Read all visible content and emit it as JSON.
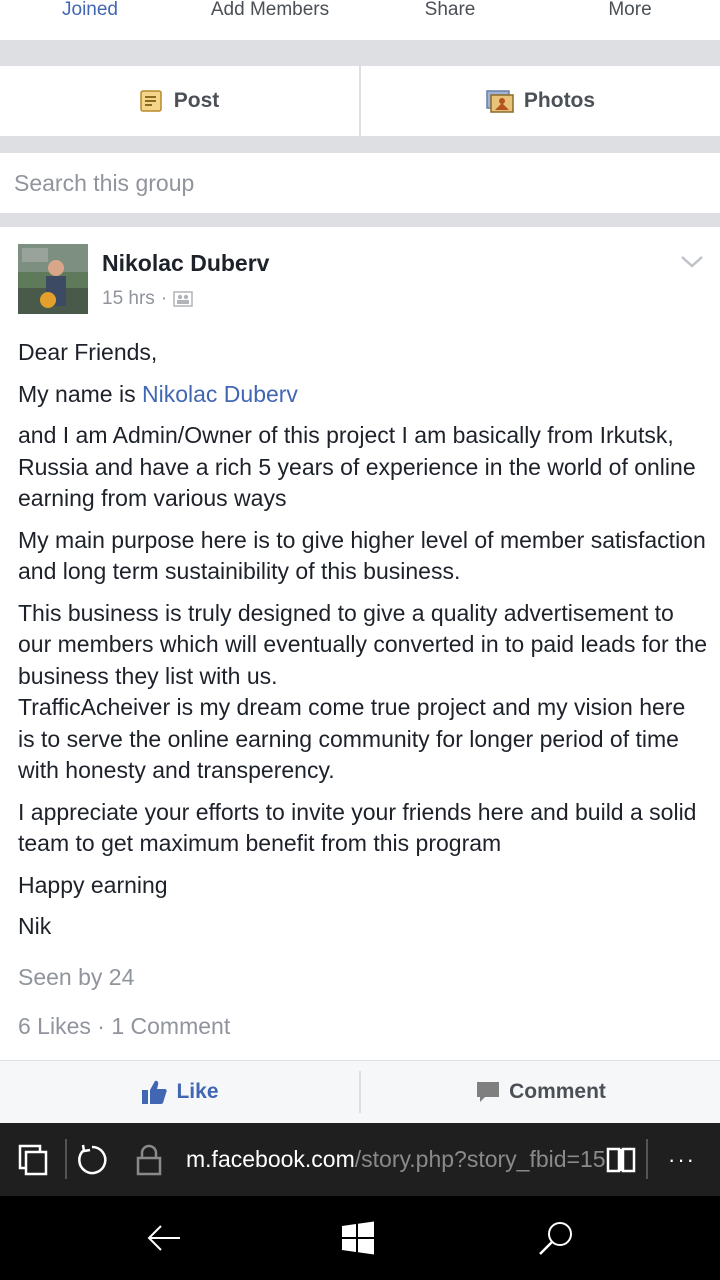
{
  "group_tabs": {
    "joined": "Joined",
    "add_members": "Add Members",
    "share": "Share",
    "more": "More"
  },
  "group_actions": {
    "post": "Post",
    "photos": "Photos"
  },
  "search": {
    "placeholder": "Search this group"
  },
  "post": {
    "author": "Nikolac Duberv",
    "time": "15 hrs",
    "meta_separator": "·",
    "paragraphs": {
      "p1": "Dear Friends,",
      "p2_prefix": "My name is ",
      "p2_link": "Nikolac Duberv",
      "p3": "and I am Admin/Owner of this project I am basically from Irkutsk, Russia and have a rich 5 years of experience in the world of online earning from various ways",
      "p4": "My main purpose here is to give higher level of member satisfaction and long term sustainibility of this business.",
      "p5a": "This business is truly designed to give a quality advertisement to our members which will eventually converted in to paid leads for the business they list with us.",
      "p5b": "TrafficAcheiver is my dream come true project and my vision here is to serve the online earning community for longer period of time with honesty and transperency.",
      "p6": "I appreciate your efforts to invite your friends here and build a solid team to get maximum benefit from this program",
      "p7": "Happy earning",
      "p8": "Nik"
    },
    "seen_by": "Seen by 24",
    "likes": "6 Likes",
    "counts_separator": "·",
    "comments": "1 Comment"
  },
  "reactions": {
    "like": "Like",
    "comment": "Comment"
  },
  "browser": {
    "url_domain": "m.facebook.com",
    "url_path": "/story.php?story_fbid=15",
    "more": "···"
  },
  "colors": {
    "facebook_blue": "#4267b2",
    "divider_gray": "#dddfe2",
    "meta_gray": "#90949c"
  },
  "icons": [
    "post-note-icon",
    "photos-icon",
    "audience-group-icon",
    "chevron-down-icon",
    "thumbs-up-icon",
    "comment-bubble-icon",
    "tabs-icon",
    "refresh-icon",
    "lock-icon",
    "reading-view-icon",
    "back-arrow-icon",
    "windows-start-icon",
    "search-icon"
  ]
}
